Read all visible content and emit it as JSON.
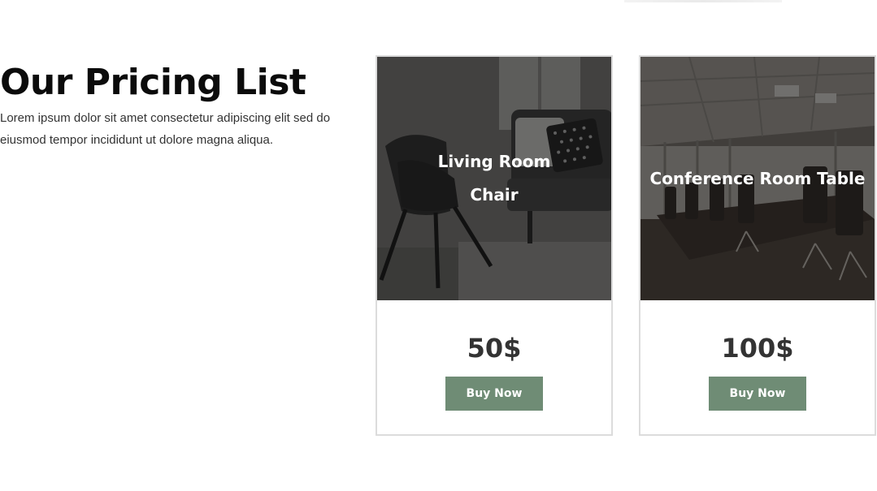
{
  "intro": {
    "heading": "Our Pricing List",
    "description": "Lorem ipsum dolor sit amet consectetur adipiscing elit sed do eiusmod tempor incididunt ut dolore magna aliqua."
  },
  "products": [
    {
      "title": "Living Room Chair",
      "price": "50$",
      "button_label": "Buy Now",
      "image": "living-room-chair-photo"
    },
    {
      "title": "Conference Room Table",
      "price": "100$",
      "button_label": "Buy Now",
      "image": "conference-room-photo"
    }
  ],
  "colors": {
    "button": "#6f8c75",
    "button_text": "#ffffff",
    "price_text": "#333333",
    "heading": "#0b0b0b",
    "card_border": "#dcdcdc"
  }
}
